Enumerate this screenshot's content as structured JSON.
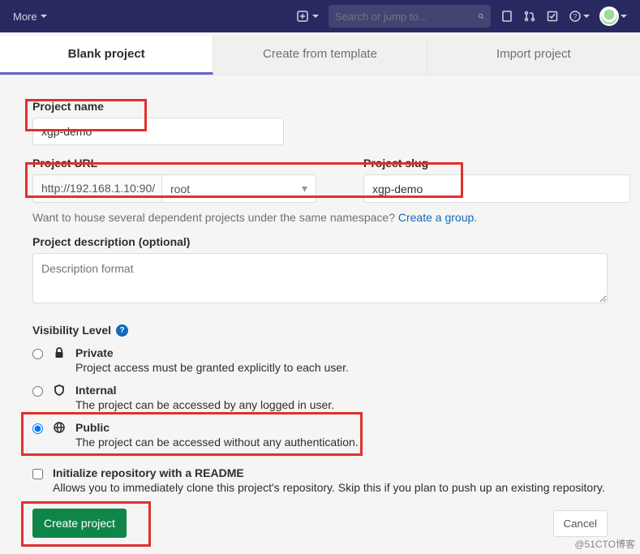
{
  "topbar": {
    "more": "More",
    "search_placeholder": "Search or jump to..."
  },
  "tabs": {
    "blank": "Blank project",
    "template": "Create from template",
    "import": "Import project"
  },
  "form": {
    "name_label": "Project name",
    "name_value": "xgp-demo",
    "url_label": "Project URL",
    "url_value": "http://192.168.1.10:90/",
    "namespace": "root",
    "slug_label": "Project slug",
    "slug_value": "xgp-demo",
    "group_hint": "Want to house several dependent projects under the same namespace? ",
    "group_link": "Create a group.",
    "desc_label": "Project description (optional)",
    "desc_placeholder": "Description format",
    "visibility_label": "Visibility Level",
    "private_title": "Private",
    "private_desc": "Project access must be granted explicitly to each user.",
    "internal_title": "Internal",
    "internal_desc": "The project can be accessed by any logged in user.",
    "public_title": "Public",
    "public_desc": "The project can be accessed without any authentication.",
    "readme_title": "Initialize repository with a README",
    "readme_desc": "Allows you to immediately clone this project's repository. Skip this if you plan to push up an existing repository.",
    "create_btn": "Create project",
    "cancel_btn": "Cancel"
  },
  "watermark": "@51CTO博客"
}
